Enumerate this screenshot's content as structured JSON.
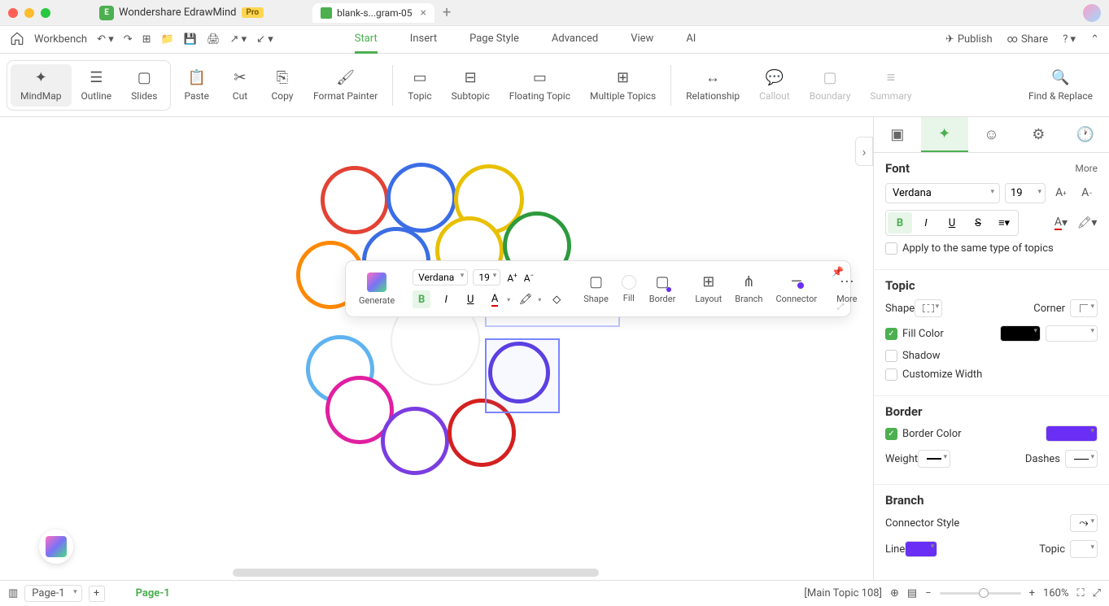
{
  "app": {
    "name": "Wondershare EdrawMind",
    "badge": "Pro"
  },
  "doc_tab": {
    "title": "blank-s...gram-05"
  },
  "menubar": {
    "workbench": "Workbench",
    "tabs": [
      "Start",
      "Insert",
      "Page Style",
      "Advanced",
      "View",
      "AI"
    ],
    "active_tab": "Start",
    "publish": "Publish",
    "share": "Share"
  },
  "ribbon": {
    "view_modes": [
      "MindMap",
      "Outline",
      "Slides"
    ],
    "active_mode": "MindMap",
    "items": [
      "Paste",
      "Cut",
      "Copy",
      "Format Painter",
      "Topic",
      "Subtopic",
      "Floating Topic",
      "Multiple Topics",
      "Relationship",
      "Callout",
      "Boundary",
      "Summary"
    ],
    "find_replace": "Find & Replace"
  },
  "float_toolbar": {
    "generate": "Generate",
    "font": "Verdana",
    "size": "19",
    "shape": "Shape",
    "fill": "Fill",
    "border": "Border",
    "layout": "Layout",
    "branch": "Branch",
    "connector": "Connector",
    "more": "More"
  },
  "side_panel": {
    "font": {
      "title": "Font",
      "more": "More",
      "family": "Verdana",
      "size": "19",
      "apply_same": "Apply to the same type of topics"
    },
    "topic": {
      "title": "Topic",
      "shape": "Shape",
      "corner": "Corner",
      "fill_color": "Fill Color",
      "shadow": "Shadow",
      "custom_width": "Customize Width"
    },
    "border": {
      "title": "Border",
      "border_color": "Border Color",
      "weight": "Weight",
      "dashes": "Dashes",
      "color_value": "#6a2ff5"
    },
    "branch": {
      "title": "Branch",
      "connector_style": "Connector Style",
      "line": "Line",
      "topic": "Topic"
    }
  },
  "status": {
    "page_select": "Page-1",
    "page_tab": "Page-1",
    "main_topic": "[Main Topic 108]",
    "zoom": "160%"
  }
}
